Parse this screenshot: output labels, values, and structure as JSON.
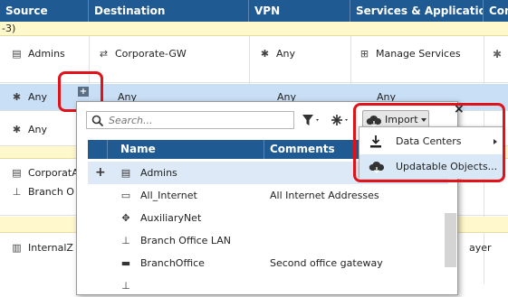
{
  "header": {
    "columns": [
      "Source",
      "Destination",
      "VPN",
      "Services & Applications",
      "Content"
    ]
  },
  "section_label": "-3)",
  "rows": {
    "r1": {
      "source": "Admins",
      "destination": "Corporate-GW",
      "vpn": "Any",
      "services": "Manage Services"
    },
    "r2": {
      "source": "Any",
      "destination": "Any",
      "vpn": "Any",
      "services": "Any"
    },
    "r3": {
      "source": "Any"
    },
    "r4": {
      "source_a": "CorporatA",
      "source_b": "Branch O"
    },
    "r5": {
      "source": "InternalZ",
      "content_tail": "ayer"
    }
  },
  "add_button_label": "+",
  "popup": {
    "search_placeholder": "Search...",
    "import_label": "Import",
    "close_label": "×",
    "columns": {
      "name": "Name",
      "comments": "Comments"
    },
    "items": [
      {
        "name": "Admins",
        "comment": ""
      },
      {
        "name": "All_Internet",
        "comment": "All Internet Addresses"
      },
      {
        "name": "AuxiliaryNet",
        "comment": ""
      },
      {
        "name": "Branch Office LAN",
        "comment": ""
      },
      {
        "name": "BranchOffice",
        "comment": "Second office gateway"
      }
    ]
  },
  "import_menu": {
    "items": [
      {
        "label": "Data Centers",
        "has_submenu": true
      },
      {
        "label": "Updatable Objects...",
        "has_submenu": false
      }
    ]
  },
  "colors": {
    "header_bg": "#1f5b92",
    "selected_row": "#c9dff5",
    "section_band": "#fff8cc",
    "highlight_box": "#e0121a"
  }
}
